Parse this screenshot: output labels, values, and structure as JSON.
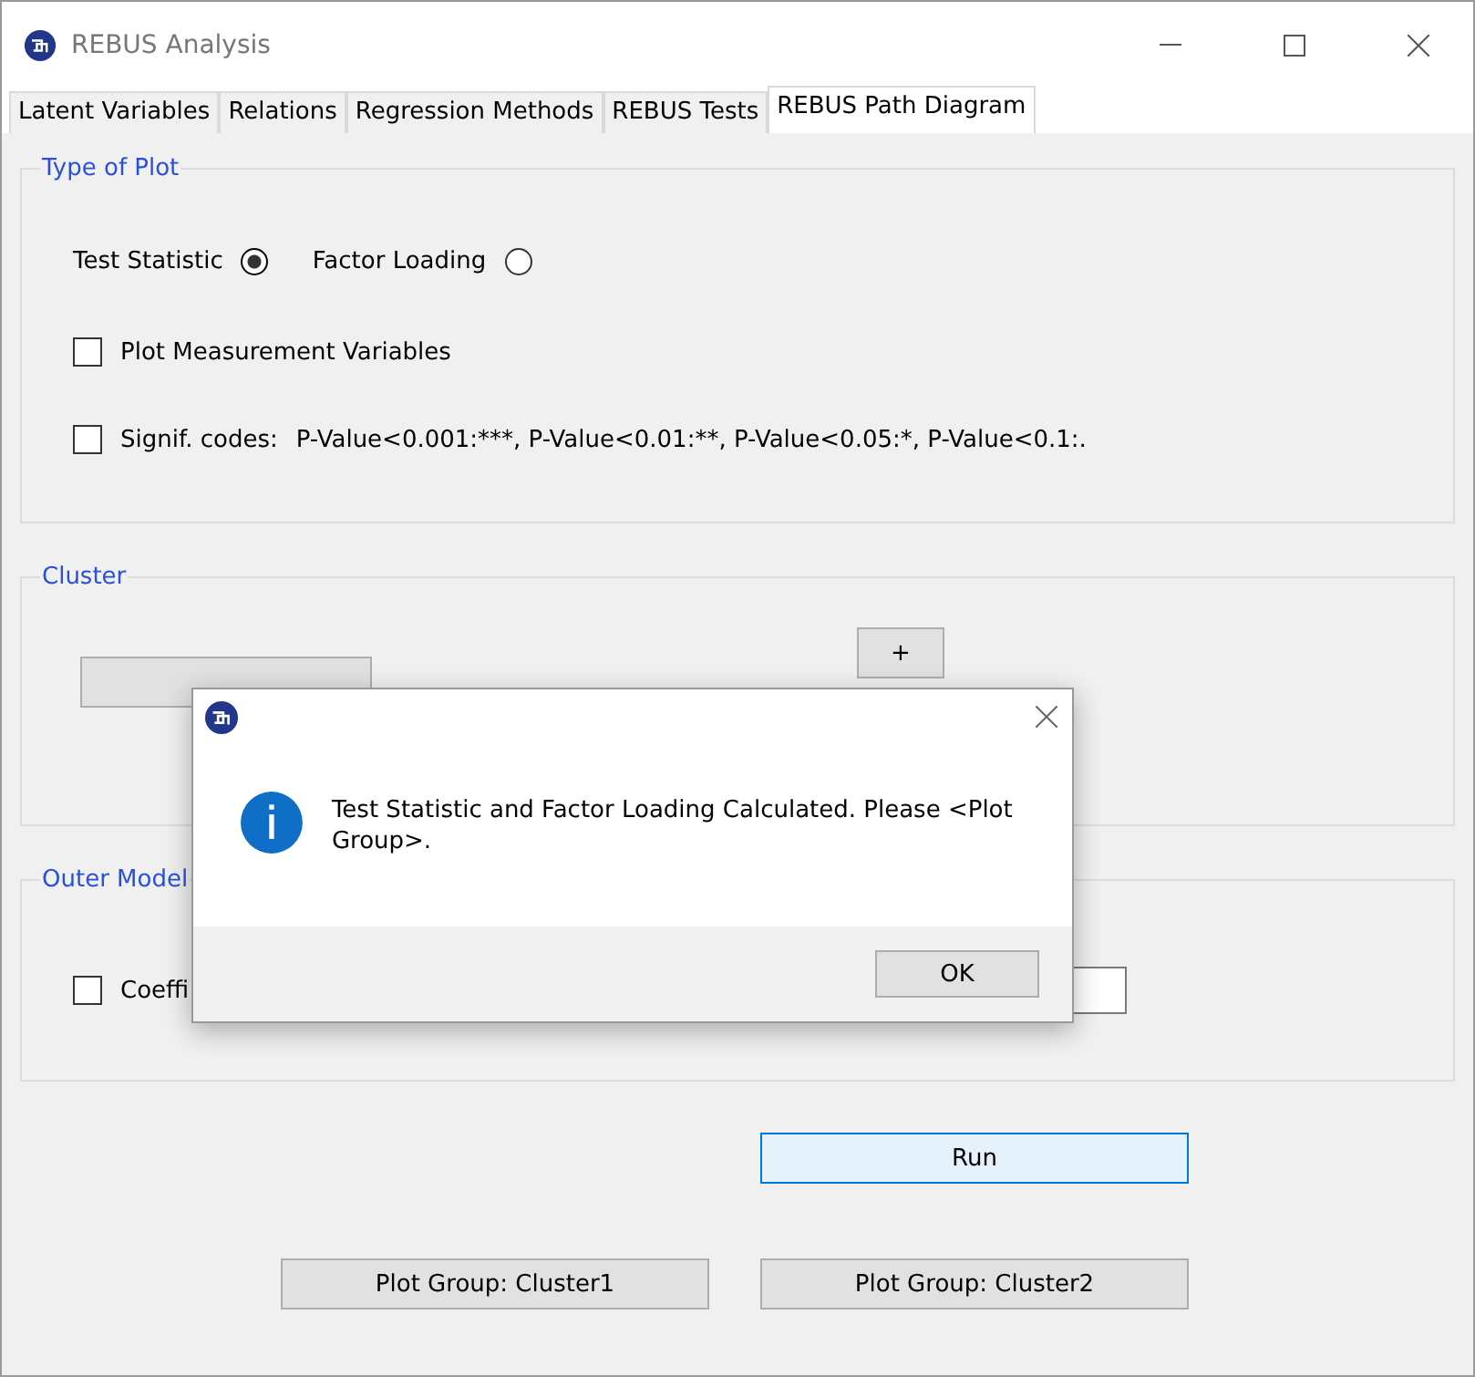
{
  "window": {
    "title": "REBUS Analysis"
  },
  "tabs": [
    {
      "label": "Latent Variables",
      "selected": false
    },
    {
      "label": "Relations",
      "selected": false
    },
    {
      "label": "Regression Methods",
      "selected": false
    },
    {
      "label": "REBUS Tests",
      "selected": false
    },
    {
      "label": "REBUS Path Diagram",
      "selected": true
    }
  ],
  "type_of_plot": {
    "legend": "Type of Plot",
    "radios": [
      {
        "label": "Test Statistic",
        "selected": true
      },
      {
        "label": "Factor Loading",
        "selected": false
      }
    ],
    "checkboxes": [
      {
        "label": "Plot Measurement Variables",
        "checked": false
      },
      {
        "label": "Signif. codes:",
        "checked": false,
        "note": "P-Value<0.001:***, P-Value<0.01:**, P-Value<0.05:*, P-Value<0.1:."
      }
    ]
  },
  "cluster": {
    "legend": "Cluster",
    "plus_button": "+"
  },
  "outer_model": {
    "legend": "Outer Model",
    "checkbox": {
      "label": "Coeffi",
      "checked": false
    }
  },
  "run_button": "Run",
  "plot_buttons": [
    "Plot Group: Cluster1",
    "Plot Group: Cluster2"
  ],
  "dialog": {
    "message": "Test Statistic and Factor Loading Calculated. Please <Plot Group>.",
    "button": "OK"
  }
}
